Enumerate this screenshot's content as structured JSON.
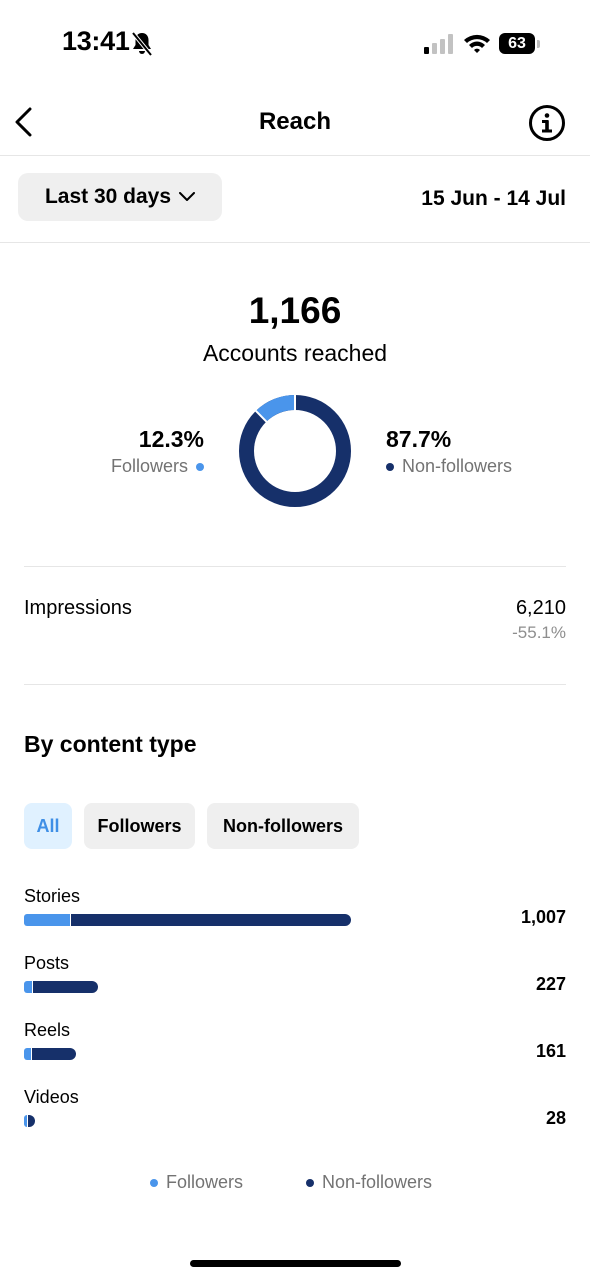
{
  "status_bar": {
    "time": "13:41",
    "battery": "63"
  },
  "header": {
    "title": "Reach"
  },
  "date_filter": {
    "selected": "Last 30 days",
    "range": "15 Jun - 14 Jul"
  },
  "summary": {
    "total": "1,166",
    "label": "Accounts reached",
    "followers_pct": "12.3%",
    "followers_label": "Followers",
    "non_followers_pct": "87.7%",
    "non_followers_label": "Non-followers"
  },
  "impressions": {
    "label": "Impressions",
    "value": "6,210",
    "change": "-55.1%"
  },
  "content_type": {
    "title": "By content type",
    "filters": [
      "All",
      "Followers",
      "Non-followers"
    ],
    "active_filter": "All",
    "rows": [
      {
        "label": "Stories",
        "value": "1,007",
        "total": 1007,
        "followers_share": 0.14
      },
      {
        "label": "Posts",
        "value": "227",
        "total": 227,
        "followers_share": 0.11
      },
      {
        "label": "Reels",
        "value": "161",
        "total": 161,
        "followers_share": 0.13
      },
      {
        "label": "Videos",
        "value": "28",
        "total": 28,
        "followers_share": 0.2
      }
    ],
    "legend": {
      "followers": "Followers",
      "non_followers": "Non-followers"
    }
  },
  "colors": {
    "followers": "#4a95eb",
    "non_followers": "#16306a",
    "active_chip_bg": "#e0f1ff",
    "active_chip_text": "#3f8fe6",
    "chip_bg": "#efefef",
    "muted_text": "#737373"
  },
  "icons": {
    "status": [
      "bell-slash-icon",
      "cellular-signal-icon",
      "wifi-icon",
      "battery-icon"
    ],
    "header": [
      "chevron-left-icon",
      "info-icon"
    ],
    "filter": "chevron-down-icon"
  }
}
